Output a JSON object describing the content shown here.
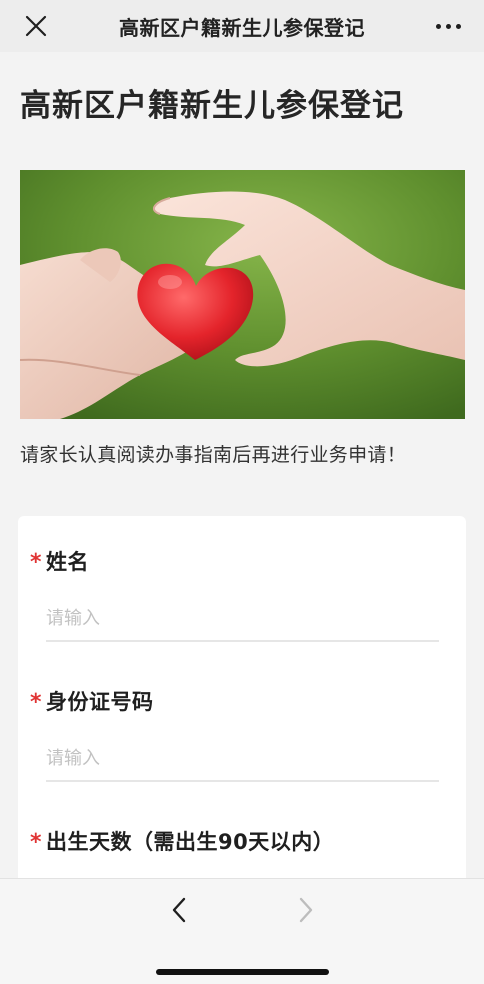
{
  "topbar": {
    "title": "高新区户籍新生儿参保登记",
    "close_icon": "close-icon",
    "more_icon": "more-icon"
  },
  "page": {
    "title": "高新区户籍新生儿参保登记",
    "banner_alt_icon": "heart-hands-image",
    "notice": "请家长认真阅读办事指南后再进行业务申请！"
  },
  "form": {
    "fields": [
      {
        "label": "姓名",
        "required_mark": "*",
        "placeholder": "请输入",
        "value": ""
      },
      {
        "label": "身份证号码",
        "required_mark": "*",
        "placeholder": "请输入",
        "value": ""
      },
      {
        "label": "出生天数（需出生90天以内）",
        "required_mark": "*",
        "placeholder": "",
        "value": ""
      }
    ]
  },
  "bottombar": {
    "back_icon": "chevron-left-icon",
    "forward_icon": "chevron-right-icon"
  },
  "colors": {
    "required": "#e03434",
    "placeholder": "#c2c2c2",
    "background": "#f3f3f3",
    "card": "#ffffff"
  }
}
